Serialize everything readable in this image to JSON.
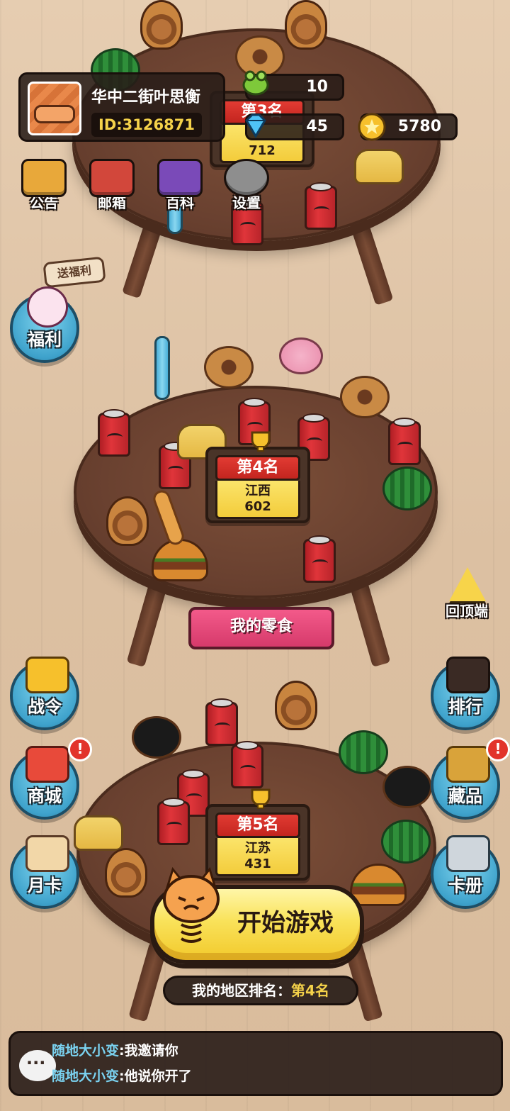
{
  "profile": {
    "name": "华中二街叶思衡",
    "id_text": "ID:3126871"
  },
  "currencies": {
    "tickets": "10",
    "gems": "45",
    "coins": "5780"
  },
  "top_buttons": [
    {
      "label": "公告",
      "icon": "bell-icon"
    },
    {
      "label": "邮箱",
      "icon": "mailbox-icon"
    },
    {
      "label": "百科",
      "icon": "encyclopedia-icon"
    },
    {
      "label": "设置",
      "icon": "gear-icon"
    }
  ],
  "gift_tag": "送福利",
  "side_left": [
    {
      "label": "福利"
    },
    {
      "label": "战令"
    },
    {
      "label": "商城"
    },
    {
      "label": "月卡"
    }
  ],
  "side_right": [
    {
      "label": "排行"
    },
    {
      "label": "藏品"
    },
    {
      "label": "卡册"
    }
  ],
  "back_to_top": "回顶端",
  "ranks": [
    {
      "place": "第3名",
      "value": "712"
    },
    {
      "place": "第4名",
      "region": "江西",
      "value": "602"
    },
    {
      "place": "第5名",
      "region": "江苏",
      "value": "431"
    }
  ],
  "my_snacks_label": "我的零食",
  "start_button": "开始游戏",
  "region_rank": {
    "label": "我的地区排名：",
    "value": "第4名"
  },
  "chat": [
    {
      "user": "随地大小变",
      "message": ":我邀请你"
    },
    {
      "user": "随地大小变",
      "message": ":他说你开了"
    }
  ],
  "badge_text": "!",
  "colors": {
    "accent_yellow": "#f5d24a",
    "rank_red": "#e23b33",
    "side_blue": "#3fa3cc",
    "banner_pink": "#f35a8a"
  }
}
